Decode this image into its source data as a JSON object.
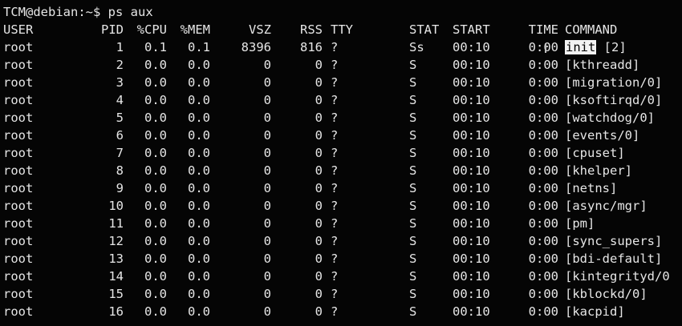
{
  "terminal": {
    "prompt": "TCM@debian:~$",
    "command": "ps aux"
  },
  "headers": {
    "user": "USER",
    "pid": "PID",
    "cpu": "%CPU",
    "mem": "%MEM",
    "vsz": "VSZ",
    "rss": "RSS",
    "tty": "TTY",
    "stat": "STAT",
    "start": "START",
    "time": "TIME",
    "command": "COMMAND"
  },
  "rows": [
    {
      "user": "root",
      "pid": "1",
      "cpu": "0.1",
      "mem": "0.1",
      "vsz": "8396",
      "rss": "816",
      "tty": "?",
      "stat": "Ss",
      "start": "00:10",
      "time": "0:00",
      "cmd_highlight": "init",
      "cmd": "[2]"
    },
    {
      "user": "root",
      "pid": "2",
      "cpu": "0.0",
      "mem": "0.0",
      "vsz": "0",
      "rss": "0",
      "tty": "?",
      "stat": "S",
      "start": "00:10",
      "time": "0:00",
      "cmd_highlight": "",
      "cmd": "[kthreadd]"
    },
    {
      "user": "root",
      "pid": "3",
      "cpu": "0.0",
      "mem": "0.0",
      "vsz": "0",
      "rss": "0",
      "tty": "?",
      "stat": "S",
      "start": "00:10",
      "time": "0:00",
      "cmd_highlight": "",
      "cmd": "[migration/0]"
    },
    {
      "user": "root",
      "pid": "4",
      "cpu": "0.0",
      "mem": "0.0",
      "vsz": "0",
      "rss": "0",
      "tty": "?",
      "stat": "S",
      "start": "00:10",
      "time": "0:00",
      "cmd_highlight": "",
      "cmd": "[ksoftirqd/0]"
    },
    {
      "user": "root",
      "pid": "5",
      "cpu": "0.0",
      "mem": "0.0",
      "vsz": "0",
      "rss": "0",
      "tty": "?",
      "stat": "S",
      "start": "00:10",
      "time": "0:00",
      "cmd_highlight": "",
      "cmd": "[watchdog/0]"
    },
    {
      "user": "root",
      "pid": "6",
      "cpu": "0.0",
      "mem": "0.0",
      "vsz": "0",
      "rss": "0",
      "tty": "?",
      "stat": "S",
      "start": "00:10",
      "time": "0:00",
      "cmd_highlight": "",
      "cmd": "[events/0]"
    },
    {
      "user": "root",
      "pid": "7",
      "cpu": "0.0",
      "mem": "0.0",
      "vsz": "0",
      "rss": "0",
      "tty": "?",
      "stat": "S",
      "start": "00:10",
      "time": "0:00",
      "cmd_highlight": "",
      "cmd": "[cpuset]"
    },
    {
      "user": "root",
      "pid": "8",
      "cpu": "0.0",
      "mem": "0.0",
      "vsz": "0",
      "rss": "0",
      "tty": "?",
      "stat": "S",
      "start": "00:10",
      "time": "0:00",
      "cmd_highlight": "",
      "cmd": "[khelper]"
    },
    {
      "user": "root",
      "pid": "9",
      "cpu": "0.0",
      "mem": "0.0",
      "vsz": "0",
      "rss": "0",
      "tty": "?",
      "stat": "S",
      "start": "00:10",
      "time": "0:00",
      "cmd_highlight": "",
      "cmd": "[netns]"
    },
    {
      "user": "root",
      "pid": "10",
      "cpu": "0.0",
      "mem": "0.0",
      "vsz": "0",
      "rss": "0",
      "tty": "?",
      "stat": "S",
      "start": "00:10",
      "time": "0:00",
      "cmd_highlight": "",
      "cmd": "[async/mgr]"
    },
    {
      "user": "root",
      "pid": "11",
      "cpu": "0.0",
      "mem": "0.0",
      "vsz": "0",
      "rss": "0",
      "tty": "?",
      "stat": "S",
      "start": "00:10",
      "time": "0:00",
      "cmd_highlight": "",
      "cmd": "[pm]"
    },
    {
      "user": "root",
      "pid": "12",
      "cpu": "0.0",
      "mem": "0.0",
      "vsz": "0",
      "rss": "0",
      "tty": "?",
      "stat": "S",
      "start": "00:10",
      "time": "0:00",
      "cmd_highlight": "",
      "cmd": "[sync_supers]"
    },
    {
      "user": "root",
      "pid": "13",
      "cpu": "0.0",
      "mem": "0.0",
      "vsz": "0",
      "rss": "0",
      "tty": "?",
      "stat": "S",
      "start": "00:10",
      "time": "0:00",
      "cmd_highlight": "",
      "cmd": "[bdi-default]"
    },
    {
      "user": "root",
      "pid": "14",
      "cpu": "0.0",
      "mem": "0.0",
      "vsz": "0",
      "rss": "0",
      "tty": "?",
      "stat": "S",
      "start": "00:10",
      "time": "0:00",
      "cmd_highlight": "",
      "cmd": "[kintegrityd/0"
    },
    {
      "user": "root",
      "pid": "15",
      "cpu": "0.0",
      "mem": "0.0",
      "vsz": "0",
      "rss": "0",
      "tty": "?",
      "stat": "S",
      "start": "00:10",
      "time": "0:00",
      "cmd_highlight": "",
      "cmd": "[kblockd/0]"
    },
    {
      "user": "root",
      "pid": "16",
      "cpu": "0.0",
      "mem": "0.0",
      "vsz": "0",
      "rss": "0",
      "tty": "?",
      "stat": "S",
      "start": "00:10",
      "time": "0:00",
      "cmd_highlight": "",
      "cmd": "[kacpid]"
    }
  ],
  "colors": {
    "background": "#050505",
    "foreground": "#e6e6e6",
    "highlight_bg": "#f2f2f2",
    "highlight_fg": "#000000"
  }
}
